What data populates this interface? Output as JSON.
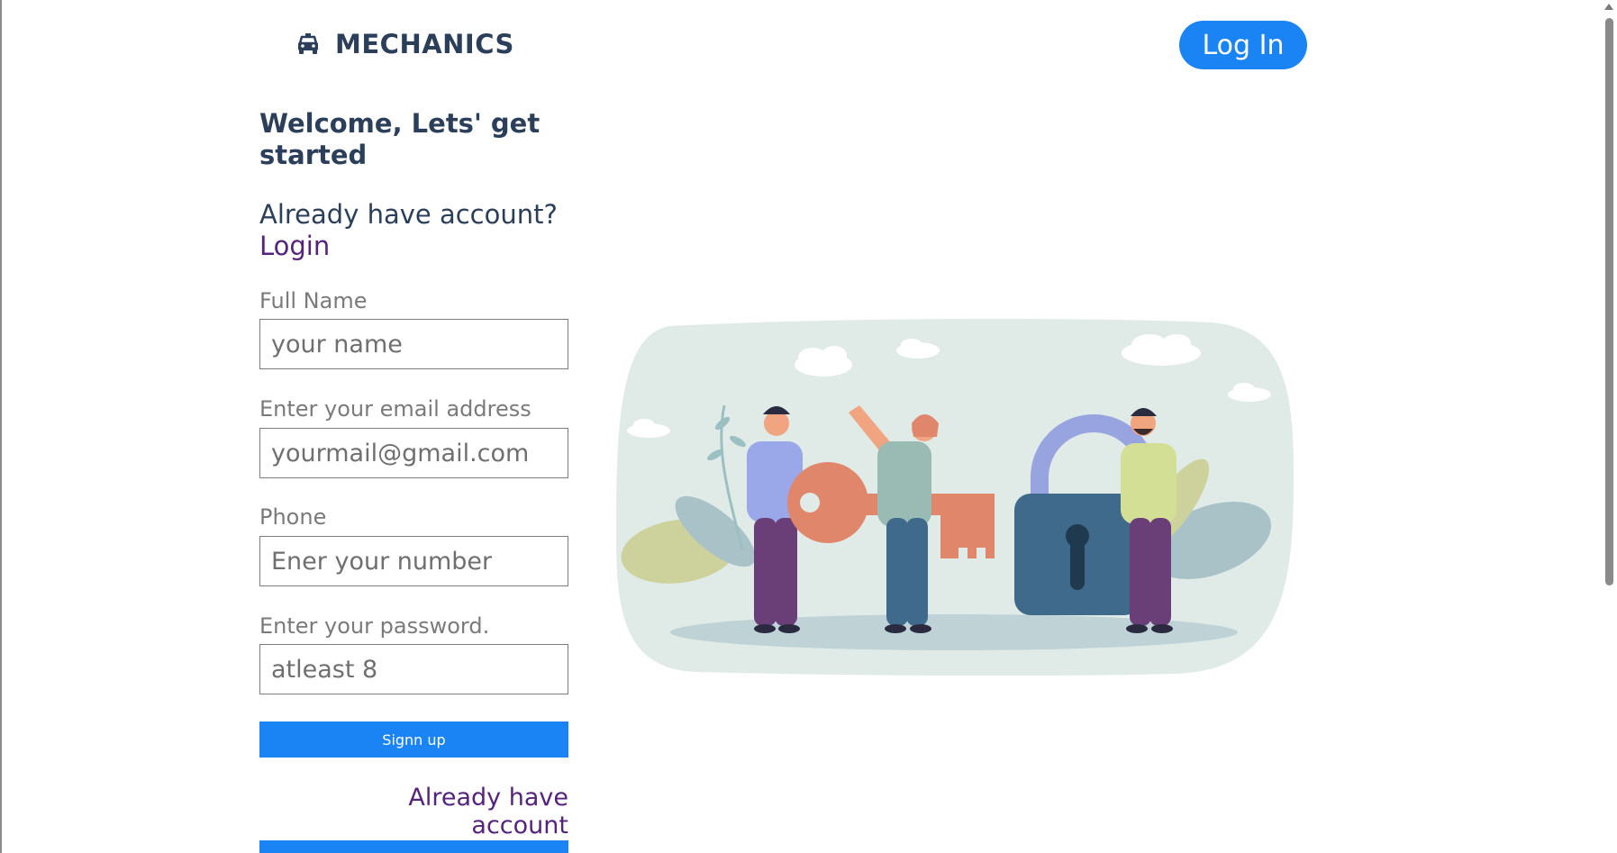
{
  "header": {
    "brand": "MECHANICS",
    "brand_icon": "car-icon",
    "login_button": "Log In"
  },
  "form": {
    "title": "Welcome, Lets' get started",
    "already_text": "Already have account?",
    "login_link": "Login",
    "full_name": {
      "label": "Full Name",
      "placeholder": "your name",
      "value": ""
    },
    "email": {
      "label": "Enter your email address",
      "placeholder": "yourmail@gmail.com",
      "value": ""
    },
    "phone": {
      "label": "Phone",
      "placeholder": "Ener your number",
      "value": ""
    },
    "password": {
      "label": "Enter your password.",
      "placeholder": "atleast 8",
      "value": ""
    },
    "signup_button": "Signn up",
    "already_account_link": "Already have account"
  },
  "colors": {
    "accent": "#1a84f5",
    "heading": "#2b3e5a",
    "link": "#55237c"
  },
  "illustration": {
    "subject": "people-holding-key-and-padlock"
  }
}
